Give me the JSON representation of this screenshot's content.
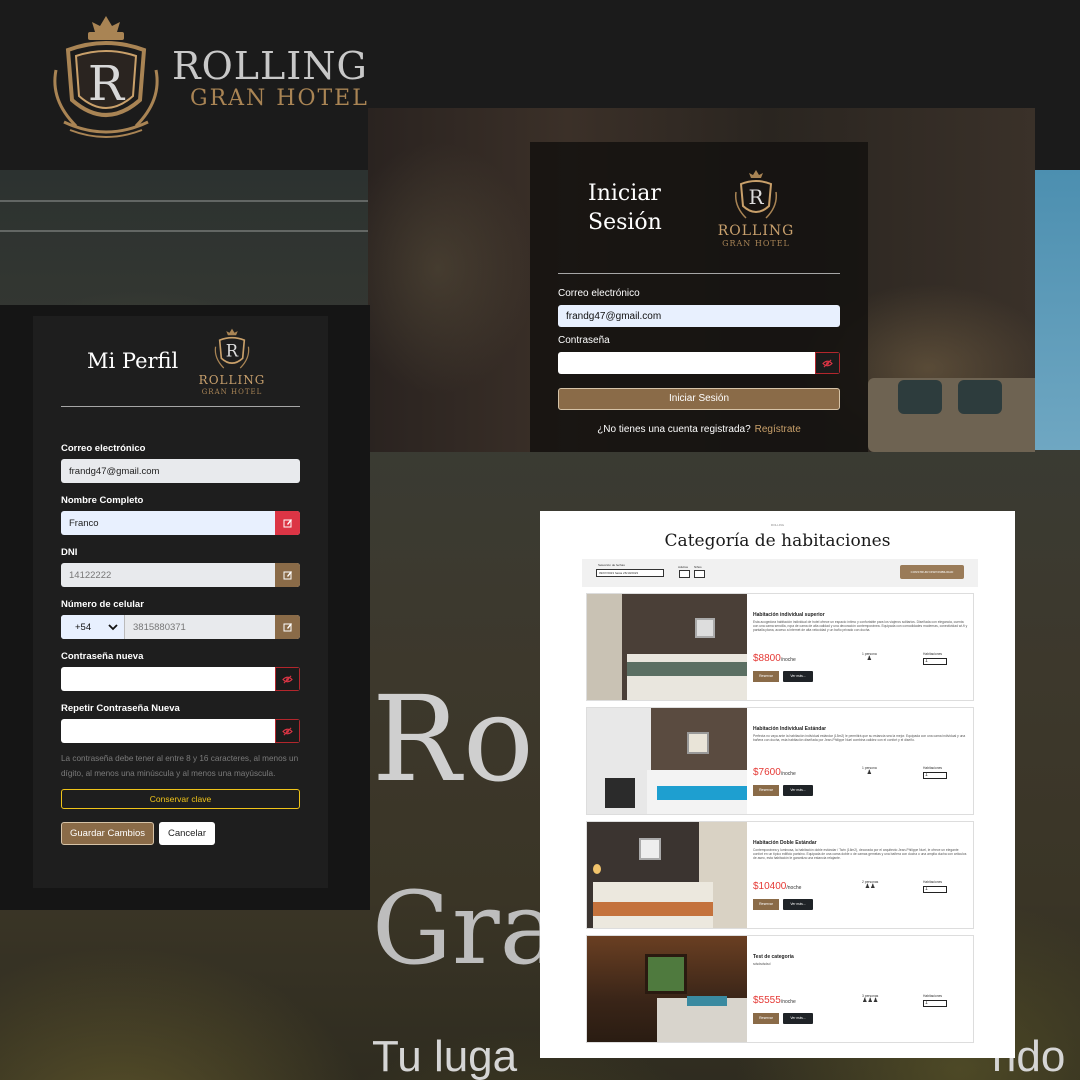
{
  "brand": {
    "name": "ROLLING",
    "subtitle": "GRAN HOTEL",
    "crest_letter": "R"
  },
  "hero": {
    "line1": "Ro",
    "line2": "Gra",
    "line3": "Tu luga",
    "line3_tail": "rido"
  },
  "login": {
    "title_line1": "Iniciar",
    "title_line2": "Sesión",
    "logo_name": "ROLLING",
    "logo_sub": "GRAN HOTEL",
    "email_label": "Correo electrónico",
    "email_value": "frandg47@gmail.com",
    "password_label": "Contraseña",
    "password_value": "",
    "submit_label": "Iniciar Sesión",
    "register_prompt": "¿No tienes una cuenta registrada?",
    "register_link": "Regístrate"
  },
  "profile": {
    "title": "Mi Perfil",
    "logo_name": "ROLLING",
    "logo_sub": "GRAN HOTEL",
    "email_label": "Correo electrónico",
    "email_value": "frandg47@gmail.com",
    "name_label": "Nombre Completo",
    "name_value": "Franco",
    "dni_label": "DNI",
    "dni_value": "14122222",
    "phone_label": "Número de celular",
    "phone_code": "+54",
    "phone_value": "3815880371",
    "new_pass_label": "Contraseña nueva",
    "repeat_pass_label": "Repetir Contraseña Nueva",
    "help_text": "La contraseña debe tener al entre 8 y 16 caracteres, al menos un dígito, al menos una minúscula y al menos una mayúscula.",
    "keep_label": "Conservar clave",
    "save_label": "Guardar Cambios",
    "cancel_label": "Cancelar"
  },
  "rooms": {
    "title": "Categoría de habitaciones",
    "filter": {
      "dates_label": "Selección de fechas",
      "dates_value": "09/07/2023 hasta 26/10/2023",
      "adults_label": "Adultos",
      "kids_label": "Niños",
      "update_label": "CONSTRUIR DISPONIBILIDAD"
    },
    "items": [
      {
        "name": "Habitación individual superior",
        "desc": "Esta acogedora habitación individual de hotel ofrece un espacio íntimo y confortable para los viajeros solitarios. Diseñada con elegancia, cuenta con una cama sencilla, ropa de cama de alta calidad y una decoración contemporánea. Equipada con comodidades modernas, conectividad wi-fi y pantalla plana, acceso a internet de alta velocidad y un baño privado con ducha.",
        "price": "$8800",
        "per": "/noche",
        "people_label": "1 persona",
        "rooms_label": "Habitaciones",
        "rooms_value": "1",
        "reserve": "Reservar",
        "more": "Ver más..."
      },
      {
        "name": "Habitación Individual Estándar",
        "desc": "Perfecta no vaya ante la habitación individual estándar (15m2) le permitirá que su estancia sea la mejor. Equipada con una cama individual y una bañera con ducha, esta habitación diseñada por Jean-Philippe Nuel combina calidez con el confort y el diseño.",
        "price": "$7600",
        "per": "/noche",
        "people_label": "1 persona",
        "rooms_label": "Habitaciones",
        "rooms_value": "1",
        "reserve": "Reservar",
        "more": "Ver más..."
      },
      {
        "name": "Habitación Doble Estándar",
        "desc": "Contemporánea y luminosa, la habitación doble estándar / Twin (16m2), decorada por el arquitecto Jean-Philippe Nuel, le ofrece un elegante confort en un típico edificio parisino. Equipada de una cama doble o de camas gemelas y una bañera con ducha o una amplia ducha con artículos de aseo, esta habitación le garantiza una estancia relajante.",
        "price": "$10400",
        "per": "/noche",
        "people_label": "2 personas",
        "rooms_label": "Habitaciones",
        "rooms_value": "1",
        "reserve": "Reservar",
        "more": "Ver más..."
      },
      {
        "name": "Test de categoría",
        "desc": "sdsdsdsdsd",
        "price": "$5555",
        "per": "/noche",
        "people_label": "3 personas",
        "rooms_label": "Habitaciones",
        "rooms_value": "1",
        "reserve": "Reservar",
        "more": "Ver más..."
      }
    ]
  },
  "colors": {
    "gold": "#c9a06a",
    "brown_button": "#8a6b48",
    "danger": "#dc3545",
    "price": "#e53935",
    "warning_outline": "#f0c419"
  },
  "icons": [
    "crest-icon",
    "eye-slash-icon",
    "edit-icon",
    "chevron-down-icon",
    "person-icon"
  ]
}
